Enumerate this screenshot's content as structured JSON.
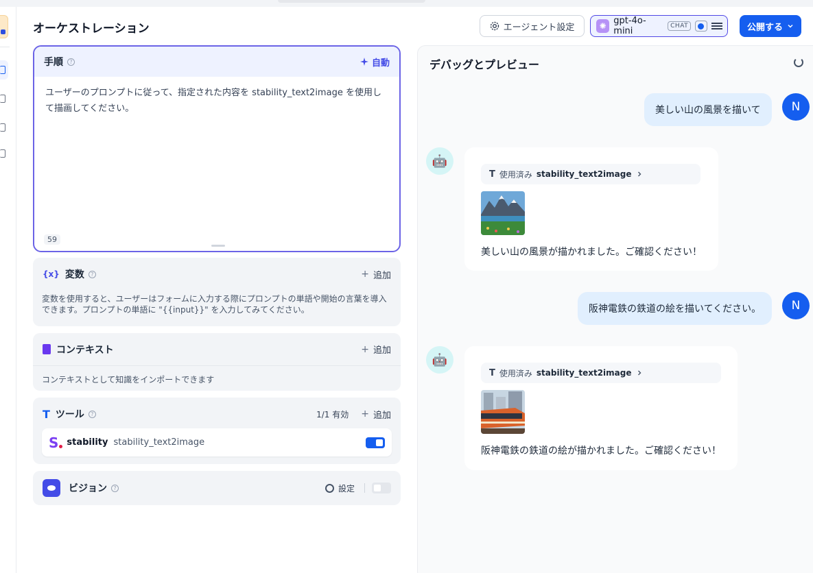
{
  "header": {
    "title": "オーケストレーション",
    "agent_settings_label": "エージェント設定",
    "model": {
      "name": "gpt-4o-mini",
      "mode_badge": "CHAT"
    },
    "publish_label": "公開する"
  },
  "instructions": {
    "title": "手順",
    "auto_label": "自動",
    "text": "ユーザーのプロンプトに従って、指定された内容を stability_text2image を使用して描画してください。",
    "char_count": "59"
  },
  "variables": {
    "title": "変数",
    "add_label": "追加",
    "description": "変数を使用すると、ユーザーはフォームに入力する際にプロンプトの単語や開始の言葉を導入できます。プロンプトの単語に \"{{input}}\" を入力してみてください。"
  },
  "context": {
    "title": "コンテキスト",
    "add_label": "追加",
    "description": "コンテキストとして知識をインポートできます"
  },
  "tools": {
    "title": "ツール",
    "count_label": "1/1 有効",
    "add_label": "追加",
    "items": [
      {
        "provider": "stability",
        "name": "stability_text2image",
        "enabled": true
      }
    ]
  },
  "vision": {
    "title": "ビジョン",
    "settings_label": "設定",
    "enabled": false
  },
  "debug": {
    "title": "デバッグとプレビュー",
    "messages": [
      {
        "role": "user",
        "avatar": "N",
        "text": "美しい山の風景を描いて"
      },
      {
        "role": "bot",
        "tool_used_label": "使用済み",
        "tool_name": "stability_text2image",
        "text": "美しい山の風景が描かれました。ご確認ください！"
      },
      {
        "role": "user",
        "avatar": "N",
        "text": "阪神電鉄の鉄道の絵を描いてください。"
      },
      {
        "role": "bot",
        "tool_used_label": "使用済み",
        "tool_name": "stability_text2image",
        "text": "阪神電鉄の鉄道の絵が描かれました。ご確認ください！"
      }
    ]
  },
  "colors": {
    "accent": "#155eef",
    "instruction_border": "#6b63e6",
    "user_bubble": "#e1effe"
  }
}
